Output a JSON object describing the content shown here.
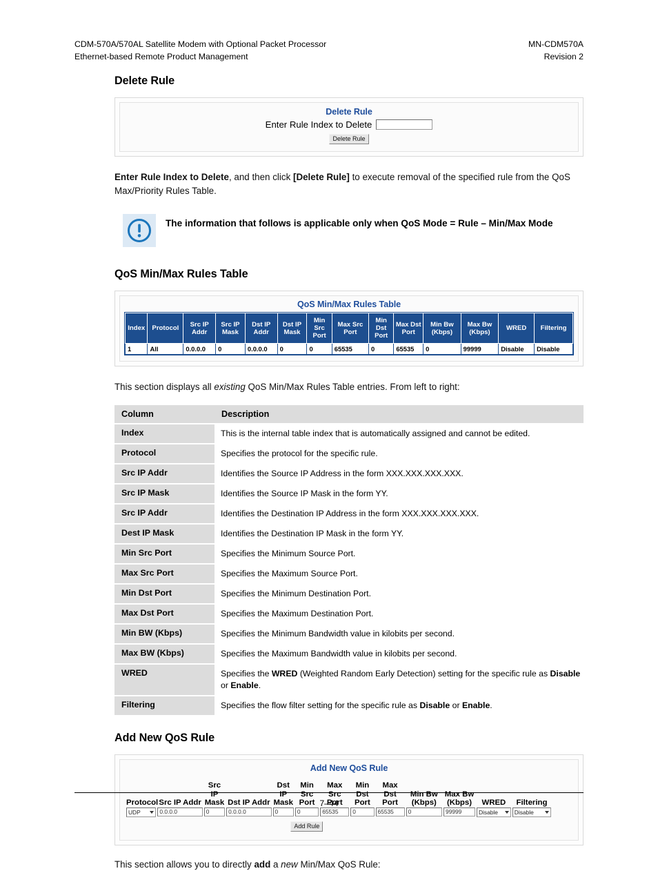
{
  "page_header": {
    "left_line1": "CDM-570A/570AL Satellite Modem with Optional Packet Processor",
    "left_line2": "Ethernet-based Remote Product Management",
    "right_line1": "MN-CDM570A",
    "right_line2": "Revision 2"
  },
  "colors": {
    "table_header_blue": "#1d4e8f",
    "gui_title_blue": "#1f4e9c",
    "desc_gray": "#dcdcdc",
    "note_icon_bg": "#dce9f5"
  },
  "delete_rule": {
    "heading": "Delete Rule",
    "gui_title": "Delete Rule",
    "label": "Enter Rule Index to Delete",
    "input_value": "",
    "button_label": "Delete Rule",
    "paragraph": {
      "part1_bold": "Enter Rule Index to Delete",
      "part2": ", and then click ",
      "part3_bold": "[Delete Rule]",
      "part4": " to execute removal of the specified rule from the QoS Max/Priority Rules Table."
    }
  },
  "note": {
    "icon": "exclamation-circle-icon",
    "text": "The information that follows is applicable only when QoS Mode = Rule – Min/Max Mode"
  },
  "qos_table_section": {
    "heading": "QoS Min/Max Rules Table",
    "gui_title": "QoS Min/Max Rules Table",
    "headers": [
      "Index",
      "Protocol",
      "Src IP Addr",
      "Src IP Mask",
      "Dst IP Addr",
      "Dst IP Mask",
      "Min Src Port",
      "Max Src Port",
      "Min Dst Port",
      "Max Dst Port",
      "Min Bw (Kbps)",
      "Max Bw (Kbps)",
      "WRED",
      "Filtering"
    ],
    "rows": [
      [
        "1",
        "All",
        "0.0.0.0",
        "0",
        "0.0.0.0",
        "0",
        "0",
        "65535",
        "0",
        "65535",
        "0",
        "99999",
        "Disable",
        "Disable"
      ]
    ],
    "intro": {
      "part1": "This section displays all ",
      "part2_italic": "existing",
      "part3": " QoS Min/Max Rules Table entries. From left to right:"
    }
  },
  "description_table": {
    "col_header_1": "Column",
    "col_header_2": "Description",
    "rows": [
      {
        "column": "Index",
        "description": "This is the internal table index that is automatically assigned and cannot be edited."
      },
      {
        "column": "Protocol",
        "description": "Specifies the protocol for the specific rule."
      },
      {
        "column": "Src IP Addr",
        "description": "Identifies the Source IP Address in the form XXX.XXX.XXX.XXX."
      },
      {
        "column": "Src IP Mask",
        "description": "Identifies the Source IP Mask in the form YY."
      },
      {
        "column": "Src IP Addr",
        "description": "Identifies the Destination IP Address in the form XXX.XXX.XXX.XXX."
      },
      {
        "column": "Dest IP Mask",
        "description": "Identifies the Destination IP Mask in the form YY."
      },
      {
        "column": "Min Src Port",
        "description": "Specifies the Minimum Source Port."
      },
      {
        "column": "Max Src Port",
        "description": "Specifies the Maximum Source Port."
      },
      {
        "column": "Min Dst Port",
        "description": "Specifies the Minimum Destination Port."
      },
      {
        "column": "Max Dst Port",
        "description": "Specifies the Maximum Destination Port."
      },
      {
        "column": "Min BW (Kbps)",
        "description": "Specifies the Minimum Bandwidth value in kilobits per second."
      },
      {
        "column": "Max BW (Kbps)",
        "description": "Specifies the Maximum Bandwidth value in kilobits per second."
      },
      {
        "column": "WRED",
        "description": "",
        "rich": [
          "Specifies the ",
          "WRED",
          " (Weighted Random Early Detection) setting for the specific rule as ",
          "Disable",
          " or ",
          "Enable",
          "."
        ]
      },
      {
        "column": "Filtering",
        "description": "",
        "rich": [
          "Specifies the flow filter setting for the specific rule as ",
          "Disable",
          " or ",
          "Enable",
          "."
        ]
      }
    ]
  },
  "add_rule_section": {
    "heading": "Add New QoS Rule",
    "gui_title": "Add New QoS Rule",
    "headers": [
      "Protocol",
      "Src IP Addr",
      "Src IP Mask",
      "Dst IP Addr",
      "Dst IP Mask",
      "Min Src Port",
      "Max Src Port",
      "Min Dst Port",
      "Max Dst Port",
      "Min Bw (Kbps)",
      "Max Bw (Kbps)",
      "WRED",
      "Filtering"
    ],
    "fields": {
      "protocol": "UDP",
      "src_ip_addr": "0.0.0.0",
      "src_ip_mask": "0",
      "dst_ip_addr": "0.0.0.0",
      "dst_ip_mask": "0",
      "min_src_port": "0",
      "max_src_port": "65535",
      "min_dst_port": "0",
      "max_dst_port": "65535",
      "min_bw": "0",
      "max_bw": "99999",
      "wred": "Disable",
      "filtering": "Disable"
    },
    "button_label": "Add Rule",
    "paragraph": {
      "part1": "This section allows you to directly ",
      "part2_bold": "add",
      "part3": " a ",
      "part4_italic": "new",
      "part5": " Min/Max QoS Rule:"
    }
  },
  "footer": {
    "page_number": "7–44"
  }
}
